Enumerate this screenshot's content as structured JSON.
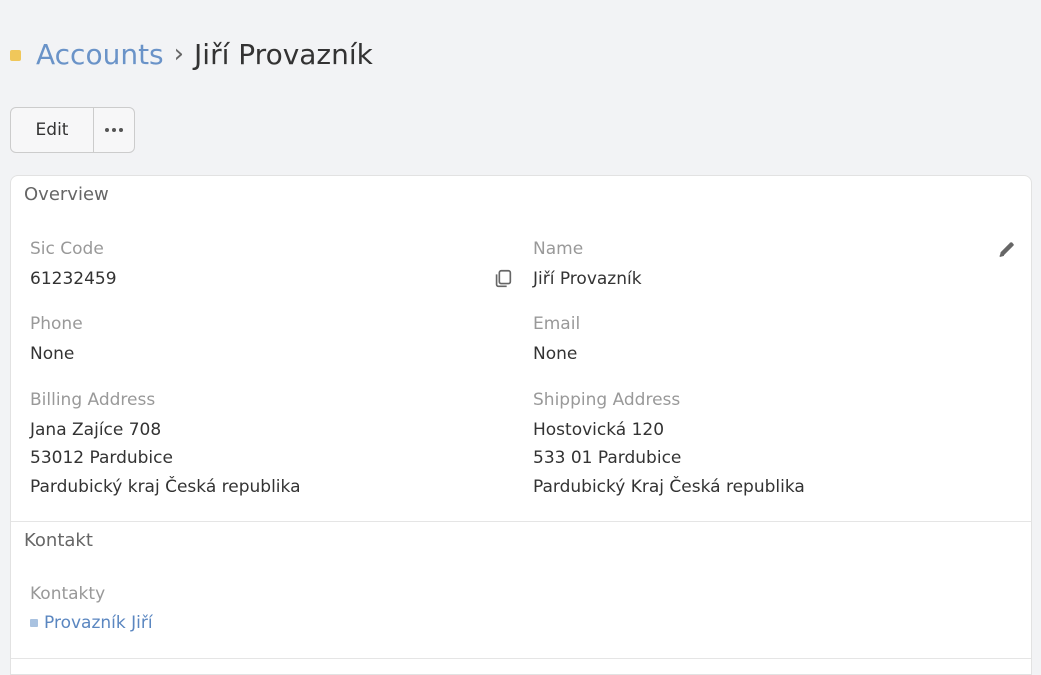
{
  "breadcrumb": {
    "parent": "Accounts",
    "separator": "›",
    "current": "Jiří Provazník"
  },
  "toolbar": {
    "edit_label": "Edit"
  },
  "overview": {
    "title": "Overview",
    "sic_code": {
      "label": "Sic Code",
      "value": "61232459"
    },
    "name": {
      "label": "Name",
      "value": "Jiří Provazník"
    },
    "phone": {
      "label": "Phone",
      "value": "None"
    },
    "email": {
      "label": "Email",
      "value": "None"
    },
    "billing_address": {
      "label": "Billing Address",
      "lines": [
        "Jana Zajíce 708",
        "53012 Pardubice",
        "Pardubický kraj Česká republika"
      ]
    },
    "shipping_address": {
      "label": "Shipping Address",
      "lines": [
        "Hostovická 120",
        "533 01 Pardubice",
        "Pardubický Kraj Česká republika"
      ]
    }
  },
  "kontakt": {
    "title": "Kontakt",
    "kontakty_label": "Kontakty",
    "contacts": [
      "Provazník Jiří"
    ]
  },
  "colors": {
    "background": "#f2f3f5",
    "link": "#6a93c8",
    "breadcrumb_marker": "#f0c75a",
    "label": "#999999",
    "text": "#333333"
  },
  "icons": {
    "copy": "copy-icon",
    "edit": "pencil-icon",
    "more": "more-horizontal-icon"
  }
}
